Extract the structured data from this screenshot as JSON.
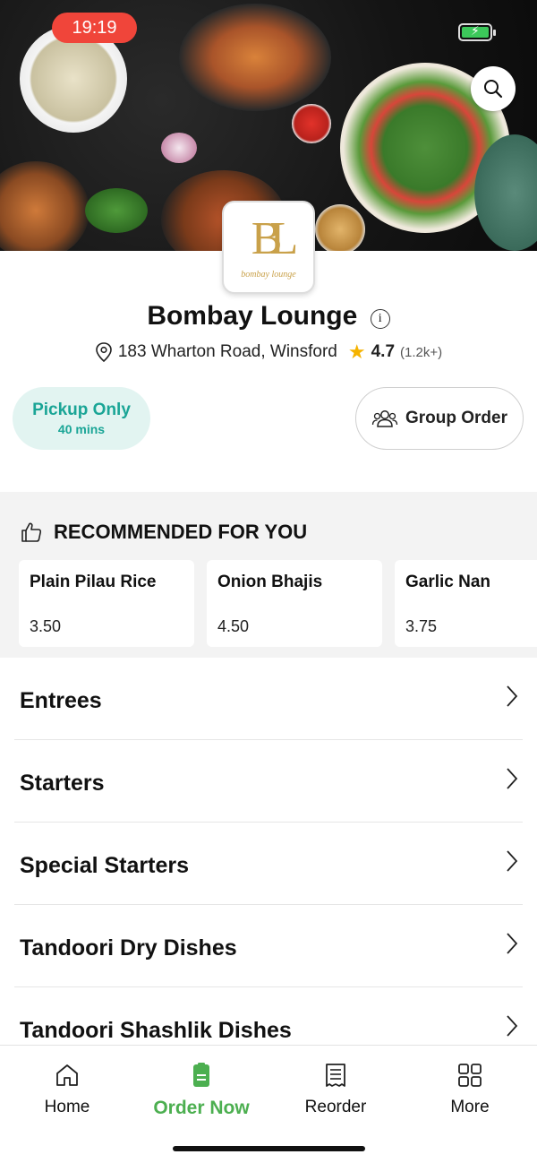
{
  "status_bar": {
    "time": "19:19"
  },
  "restaurant": {
    "logo_mono": "BL",
    "logo_text": "bombay lounge",
    "name": "Bombay Lounge",
    "address": "183 Wharton Road, Winsford",
    "rating": "4.7",
    "rating_count": "(1.2k+)"
  },
  "pickup": {
    "label": "Pickup Only",
    "time": "40 mins"
  },
  "group_order": {
    "label": "Group Order"
  },
  "recommended": {
    "title": "RECOMMENDED FOR YOU",
    "items": [
      {
        "name": "Plain Pilau Rice",
        "price": "3.50"
      },
      {
        "name": "Onion Bhajis",
        "price": "4.50"
      },
      {
        "name": "Garlic Nan",
        "price": "3.75"
      }
    ]
  },
  "categories": [
    {
      "label": "Entrees"
    },
    {
      "label": "Starters"
    },
    {
      "label": "Special Starters"
    },
    {
      "label": "Tandoori Dry Dishes"
    },
    {
      "label": "Tandoori Shashlik Dishes"
    }
  ],
  "tabbar": {
    "items": [
      {
        "label": "Home",
        "icon": "home-icon"
      },
      {
        "label": "Order Now",
        "icon": "order-icon"
      },
      {
        "label": "Reorder",
        "icon": "receipt-icon"
      },
      {
        "label": "More",
        "icon": "grid-icon"
      }
    ]
  },
  "colors": {
    "accent": "#4caf50",
    "teal": "#1aa596",
    "time_pill": "#f0453a",
    "star": "#f5b300"
  }
}
